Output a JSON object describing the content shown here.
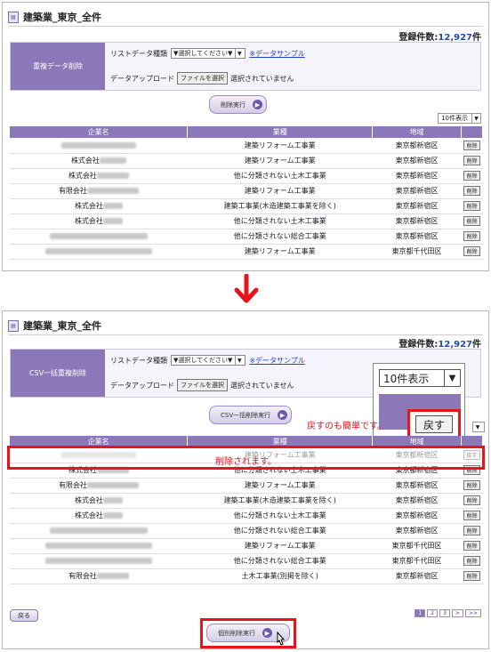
{
  "before": {
    "title": "建築業_東京_全件",
    "count_label": "登録件数:",
    "count_value": "12,927",
    "count_unit": "件",
    "form_label": "重複データ削除",
    "list_type_label": "リストデータ種類",
    "list_type_value": "▼選択してください▼",
    "sample_link": "※データサンプル",
    "upload_label": "データアップロード",
    "file_button": "ファイルを選択",
    "file_status": "選択されていません",
    "execute_button": "削除実行",
    "per_page": "10件表示",
    "columns": [
      "企業名",
      "業種",
      "地域",
      ""
    ],
    "rows": [
      {
        "company": "",
        "industry": "建築リフォーム工事業",
        "region": "東京都新宿区",
        "action": "削除"
      },
      {
        "company": "株式会社",
        "industry": "建築リフォーム工事業",
        "region": "東京都新宿区",
        "action": "削除"
      },
      {
        "company": "株式会社",
        "industry": "他に分類されない土木工事業",
        "region": "東京都新宿区",
        "action": "削除"
      },
      {
        "company": "有限会社",
        "industry": "建築リフォーム工事業",
        "region": "東京都新宿区",
        "action": "削除"
      },
      {
        "company": "株式会社",
        "industry": "建築工事業(木造建築工事業を除く)",
        "region": "東京都新宿区",
        "action": "削除"
      },
      {
        "company": "株式会社",
        "industry": "他に分類されない土木工事業",
        "region": "東京都新宿区",
        "action": "削除"
      },
      {
        "company": "",
        "industry": "他に分類されない総合工事業",
        "region": "東京都新宿区",
        "action": "削除"
      },
      {
        "company": "",
        "industry": "建築リフォーム工事業",
        "region": "東京都千代田区",
        "action": "削除"
      }
    ]
  },
  "after": {
    "title": "建築業_東京_全件",
    "count_label": "登録件数:",
    "count_value": "12,927",
    "count_unit": "件",
    "form_label": "CSV一括重複削除",
    "list_type_label": "リストデータ種類",
    "list_type_value": "▼選択してください▼",
    "sample_link": "※データサンプル",
    "upload_label": "データアップロード",
    "file_button": "ファイルを選択",
    "file_status": "選択されていません",
    "execute_button": "CSV一括削除実行",
    "per_page": "10件表示",
    "per_page_zoom": "10件表示",
    "undo_note": "戻すのも簡単です。",
    "undo_button": "戻す",
    "deleted_note": "削除されます。",
    "columns": [
      "企業名",
      "業種",
      "地域",
      ""
    ],
    "rows": [
      {
        "company": "",
        "industry": "建築リフォーム工事業",
        "region": "東京都新宿区",
        "action": "戻す"
      },
      {
        "company": "株式会社",
        "industry": "他に分類されない土木工事業",
        "region": "東京都新宿区",
        "action": "削除"
      },
      {
        "company": "有限会社",
        "industry": "建築リフォーム工事業",
        "region": "東京都新宿区",
        "action": "削除"
      },
      {
        "company": "株式会社",
        "industry": "建築工事業(木造建築工事業を除く)",
        "region": "東京都新宿区",
        "action": "削除"
      },
      {
        "company": "株式会社",
        "industry": "他に分類されない土木工事業",
        "region": "東京都新宿区",
        "action": "削除"
      },
      {
        "company": "",
        "industry": "他に分類されない総合工事業",
        "region": "東京都新宿区",
        "action": "削除"
      },
      {
        "company": "",
        "industry": "建築リフォーム工事業",
        "region": "東京都千代田区",
        "action": "削除"
      },
      {
        "company": "",
        "industry": "他に分類されない総合工事業",
        "region": "東京都千代田区",
        "action": "削除"
      },
      {
        "company": "有限会社",
        "industry": "土木工事業(別掲を除く)",
        "region": "東京都新宿区",
        "action": "削除"
      }
    ],
    "back_button": "戻る",
    "pages": [
      "1",
      "2",
      "3",
      ">",
      ">>"
    ],
    "bulk_delete_button": "個別削除実行"
  },
  "colors": {
    "accent": "#8b78b8",
    "highlight": "#e8141b",
    "count": "#1f4fa0"
  }
}
